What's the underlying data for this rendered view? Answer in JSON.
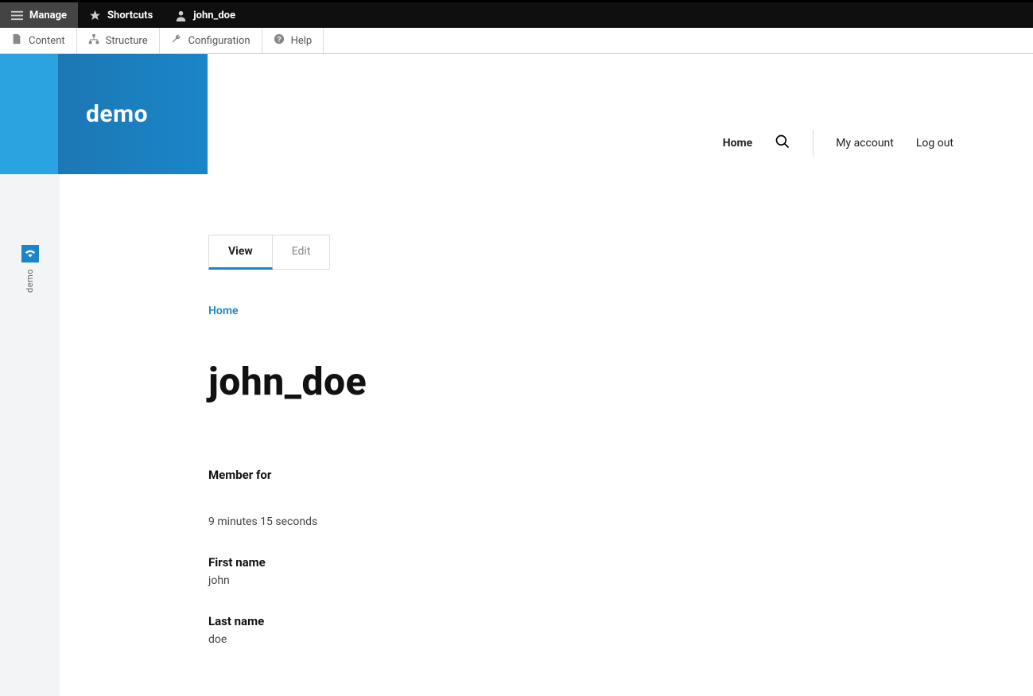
{
  "toolbar_top": {
    "manage": "Manage",
    "shortcuts": "Shortcuts",
    "user": "john_doe"
  },
  "toolbar_sub": {
    "content": "Content",
    "structure": "Structure",
    "configuration": "Configuration",
    "help": "Help"
  },
  "brand": "demo",
  "left_rail": "demo",
  "site_nav": {
    "home": "Home",
    "my_account": "My account",
    "log_out": "Log out"
  },
  "tabs": {
    "view": "View",
    "edit": "Edit"
  },
  "breadcrumb": "Home",
  "page_title": "john_doe",
  "fields": {
    "member_for_label": "Member for",
    "member_for_value": "9 minutes 15 seconds",
    "first_name_label": "First name",
    "first_name_value": "john",
    "last_name_label": "Last name",
    "last_name_value": "doe"
  }
}
